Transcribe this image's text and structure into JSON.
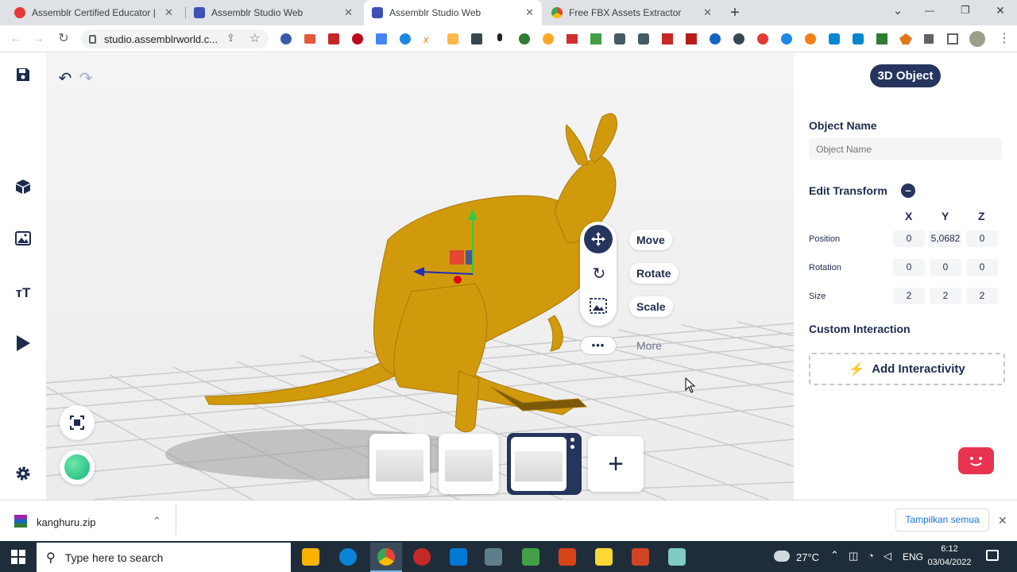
{
  "browser": {
    "tabs": [
      {
        "title": "Assemblr Certified Educator |",
        "active": false,
        "icon_color": "#e53935"
      },
      {
        "title": "Assemblr Studio Web",
        "active": false,
        "icon_color": "#3f51b5"
      },
      {
        "title": "Assemblr Studio Web",
        "active": true,
        "icon_color": "#3f51b5"
      },
      {
        "title": "Free FBX Assets Extractor",
        "active": false,
        "icon_color": "#34a853"
      }
    ],
    "close_glyph": "✕",
    "new_tab_glyph": "+",
    "url": "studio.assemblrworld.c...",
    "window_controls": {
      "menu": "⌄",
      "minimize": "—",
      "restore": "❐",
      "close": "✕"
    }
  },
  "app": {
    "undo_icon": "↶",
    "redo_icon": "↷",
    "right_panel": {
      "type_badge": "3D Object",
      "object_name_label": "Object Name",
      "object_name_placeholder": "Object Name",
      "edit_transform_label": "Edit Transform",
      "collapse_glyph": "–",
      "axis_headers": [
        "X",
        "Y",
        "Z"
      ],
      "rows": [
        {
          "label": "Position",
          "values": [
            "0",
            "5,0682",
            "0"
          ]
        },
        {
          "label": "Rotation",
          "values": [
            "0",
            "0",
            "0"
          ]
        },
        {
          "label": "Size",
          "values": [
            "2",
            "2",
            "2"
          ]
        }
      ],
      "custom_interaction_label": "Custom Interaction",
      "add_interactivity_label": "Add Interactivity"
    },
    "transform_menu": {
      "move": "Move",
      "rotate": "Rotate",
      "scale": "Scale",
      "more": "More",
      "more_glyph": "•••"
    },
    "add_scene_glyph": "+"
  },
  "download_bar": {
    "file_name": "kanghuru.zip",
    "show_all": "Tampilkan semua",
    "close_glyph": "✕"
  },
  "taskbar": {
    "search_placeholder": "Type here to search",
    "weather": "27°C",
    "language": "ENG",
    "time": "6:12",
    "date": "03/04/2022"
  },
  "colors": {
    "navy": "#1e2b4d",
    "badge": "#26355e",
    "kangaroo": "#d19a0c",
    "chat_button": "#e8344e"
  }
}
